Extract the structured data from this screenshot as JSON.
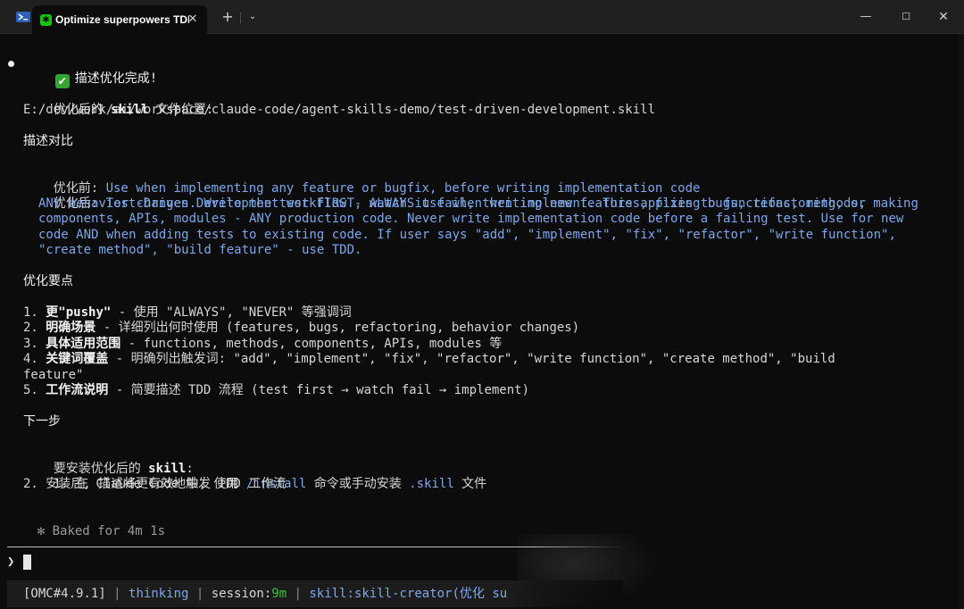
{
  "titlebar": {
    "tab_title": "Optimize superpowers TDI",
    "close_glyph": "✕",
    "new_tab_glyph": "+",
    "dropdown_glyph": "⌄",
    "minimize_glyph": "—",
    "maximize_glyph": "☐",
    "window_close_glyph": "✕",
    "icons": [
      "terminal-shell-icon",
      "tab-app-icon"
    ]
  },
  "output": {
    "done_icon": "✔",
    "done_text": "描述优化完成!",
    "location_label_a": "优化后的 ",
    "location_label_b": "skill",
    "location_label_c": " 文件位置:",
    "location_path": "E:/dev/work/ai/workspace/claude-code/agent-skills-demo/test-driven-development.skill",
    "compare_heading": "描述对比",
    "before_label": "优化前: ",
    "before_text": "Use when implementing any feature or bugfix, before writing implementation code",
    "after_label": "优化后: ",
    "after_lines": [
      "Test-Driven Development workflow - ALWAYS use when writing new features, fixing bugs, refactoring, or making",
      "ANY behavior changes. Write the test FIRST, watch it fail, then implement. This applies to functions, methods,",
      "components, APIs, modules - ANY production code. Never write implementation code before a failing test. Use for new",
      "code AND when adding tests to existing code. If user says \"add\", \"implement\", \"fix\", \"refactor\", \"write function\",",
      "\"create method\", \"build feature\" - use TDD."
    ],
    "points_heading": "优化要点",
    "points": [
      {
        "num": "1. ",
        "bold": "更\"pushy\"",
        "rest": " - 使用 \"ALWAYS\", \"NEVER\" 等强调词"
      },
      {
        "num": "2. ",
        "bold": "明确场景",
        "rest": " - 详细列出何时使用 (features, bugs, refactoring, behavior changes)"
      },
      {
        "num": "3. ",
        "bold": "具体适用范围",
        "rest": " - functions, methods, components, APIs, modules 等"
      },
      {
        "num": "4. ",
        "bold": "关键词覆盖",
        "rest": " - 明确列出触发词: \"add\", \"implement\", \"fix\", \"refactor\", \"write function\", \"create method\", \"build"
      },
      {
        "num": "",
        "bold": "",
        "rest": "feature\""
      },
      {
        "num": "5. ",
        "bold": "工作流说明",
        "rest": " - 简要描述 TDD 流程 (test first → watch fail → implement)"
      }
    ],
    "next_heading": "下一步",
    "install_intro_a": "要安装优化后的 ",
    "install_intro_b": "skill",
    "install_intro_c": ":",
    "install_step1_a": "1. 在 Claude Code 中, 使用 ",
    "install_step1_cmd": "/install",
    "install_step1_b": " 命令或手动安装 ",
    "install_step1_file": ".skill",
    "install_step1_c": " 文件",
    "install_step2": "2. 安装后, 描述将更有效地触发 TDD 工作流",
    "baked_icon": "✻",
    "baked_text": " Baked for 4m 1s"
  },
  "prompt": {
    "symbol": "❯"
  },
  "status": {
    "version": "[OMC#4.9.1]",
    "sep": " | ",
    "mode": "thinking",
    "session_label": "session:",
    "session_value": "9m",
    "skill": "skill:skill-creator(优化 su"
  },
  "colors": {
    "background": "#0c0c0c",
    "link_blue": "#7fa7e6",
    "success_green": "#33a632",
    "titlebar": "#202020"
  }
}
